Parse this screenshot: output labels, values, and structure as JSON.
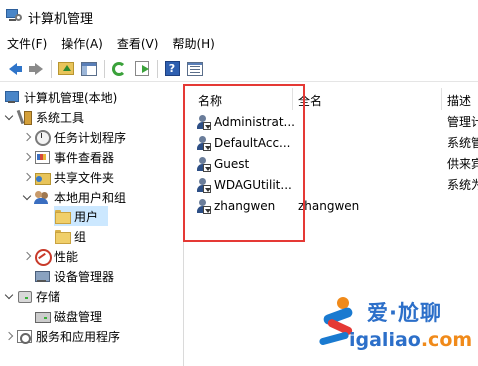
{
  "window": {
    "title": "计算机管理"
  },
  "menu": [
    "文件(F)",
    "操作(A)",
    "查看(V)",
    "帮助(H)"
  ],
  "toolbar": {
    "icons": [
      "back-arrow-icon",
      "forward-arrow-icon",
      "up-folder-icon",
      "show-hide-tree-icon",
      "refresh-icon",
      "export-list-icon",
      "help-icon",
      "action-pane-icon"
    ],
    "help_glyph": "?"
  },
  "tree": {
    "root": "计算机管理(本地)",
    "system_tools": "系统工具",
    "task_scheduler": "任务计划程序",
    "event_viewer": "事件查看器",
    "shared_folders": "共享文件夹",
    "local_users_groups": "本地用户和组",
    "users": "用户",
    "groups": "组",
    "performance": "性能",
    "device_manager": "设备管理器",
    "storage": "存储",
    "disk_management": "磁盘管理",
    "services_apps": "服务和应用程序"
  },
  "list": {
    "columns": {
      "name": "名称",
      "full_name": "全名",
      "description": "描述"
    },
    "rows": [
      {
        "name": "Administrat...",
        "full_name": "",
        "description": "管理计"
      },
      {
        "name": "DefaultAcc...",
        "full_name": "",
        "description": "系统管"
      },
      {
        "name": "Guest",
        "full_name": "",
        "description": "供来宾"
      },
      {
        "name": "WDAGUtilit...",
        "full_name": "",
        "description": "系统为"
      },
      {
        "name": "zhangwen",
        "full_name": "zhangwen",
        "description": ""
      }
    ]
  },
  "watermark": {
    "cn": "爱·尬聊",
    "en_a": "igaliao",
    "en_b": ".com"
  },
  "colors": {
    "highlight": "#e53935",
    "selected_bg": "#cce8ff",
    "watermark_blue": "#2c6fc9",
    "watermark_orange": "#f08a1a"
  }
}
